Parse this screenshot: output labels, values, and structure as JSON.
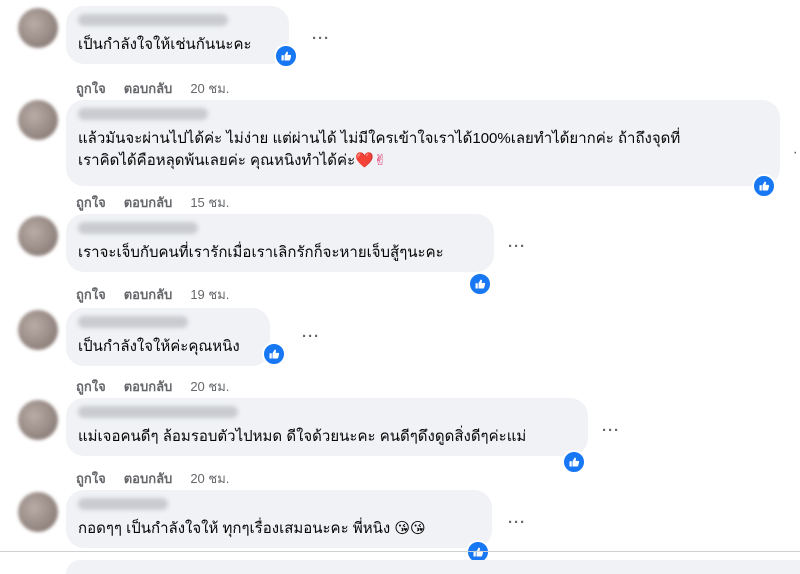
{
  "comments": [
    {
      "text": "เป็นกำลังใจให้เช่นกันนะคะ",
      "like": "ถูกใจ",
      "reply": "ตอบกลับ",
      "time": "20 ชม."
    },
    {
      "text_line1": "แล้วมันจะผ่านไปได้ค่ะ ไม่ง่าย แต่ผ่านได้ ไม่มีใครเข้าใจเราได้100%เลยทำได้ยากค่ะ ถ้าถึงจุดที่",
      "text_line2": "เราคิดได้คือหลุดพ้นเลยค่ะ คุณหนิงทำได้ค่ะ",
      "emoji": "❤️✌",
      "like": "ถูกใจ",
      "reply": "ตอบกลับ",
      "time": "15 ชม."
    },
    {
      "text": "เราจะเจ็บกับคนที่เรารักเมื่อเราเลิกรักก็จะหายเจ็บสู้ๆนะคะ",
      "like": "ถูกใจ",
      "reply": "ตอบกลับ",
      "time": "19 ชม."
    },
    {
      "text": "เป็นกำลังใจให้ค่ะคุณหนิง",
      "like": "ถูกใจ",
      "reply": "ตอบกลับ",
      "time": "20 ชม."
    },
    {
      "text": "แม่เจอคนดีๆ ล้อมรอบตัวไปหมด ดีใจด้วยนะคะ คนดีๆดึงดูดสิ่งดีๆค่ะแม่",
      "like": "ถูกใจ",
      "reply": "ตอบกลับ",
      "time": "20 ชม."
    },
    {
      "text": "กอดๆๆ เป็นกำลังใจให้ ทุกๆเรื่องเสมอนะคะ พี่หนิง",
      "emoji": "😘😘"
    }
  ],
  "more_label": "···",
  "colors": {
    "like_blue": "#1877f2",
    "bubble": "#f0f2f5",
    "meta_gray": "#65676b"
  }
}
